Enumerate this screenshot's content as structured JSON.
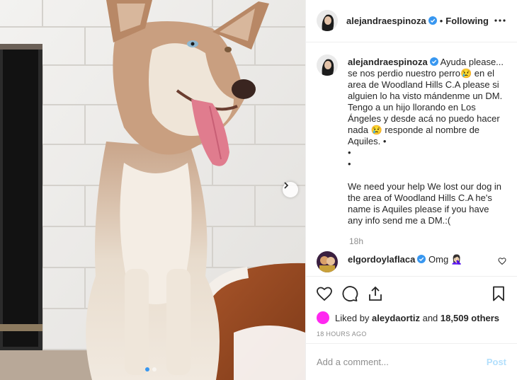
{
  "photo": {
    "carousel_total": 2,
    "carousel_current": 1
  },
  "header": {
    "username": "alejandraespinoza",
    "separator": "•",
    "follow_status": "Following"
  },
  "caption": {
    "username": "alejandraespinoza",
    "text": "Ayuda please... se nos perdio nuestro perro😢 en el area de Woodland Hills C.A please si alguien lo ha visto mándenme un DM. Tengo a un hijo llorando en Los Ángeles y desde acá no puedo hacer nada 😢 responde al nombre de Aquiles. •\n•\n•\n\nWe need your help We lost our dog in the area of Woodland Hills C.A he's name is Aquiles please if you have any info send me a DM.:(",
    "time": "18h"
  },
  "comment": {
    "username": "elgordoylaflaca",
    "text": "Omg 🤦🏻‍♀️"
  },
  "likes": {
    "prefix": "Liked by",
    "user": "aleydaortiz",
    "connector": "and",
    "others": "18,509 others"
  },
  "timestamp": "18 HOURS AGO",
  "add_comment": {
    "placeholder": "Add a comment...",
    "post_label": "Post"
  },
  "colors": {
    "verified": "#3897f0",
    "link_blue": "#3897f0",
    "post_disabled": "#b2dffc",
    "liker_avatar": "#ff28f0",
    "muted": "#8e8e8e"
  },
  "icons": [
    "verified-badge-icon",
    "more-options-icon",
    "heart-icon",
    "comment-icon",
    "share-icon",
    "bookmark-icon",
    "chevron-right-icon"
  ]
}
